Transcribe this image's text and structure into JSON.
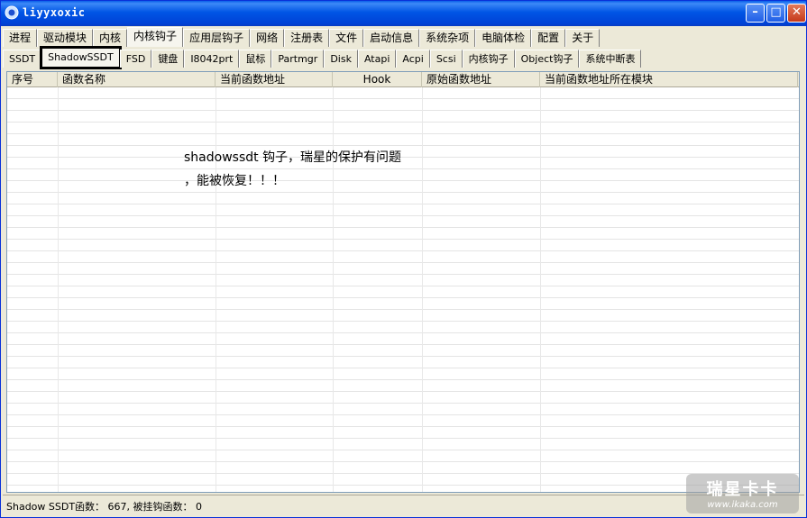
{
  "window": {
    "title": "liyyxoxic",
    "min_label": "–",
    "max_label": "□",
    "close_label": "✕"
  },
  "main_tabs": [
    "进程",
    "驱动模块",
    "内核",
    "内核钩子",
    "应用层钩子",
    "网络",
    "注册表",
    "文件",
    "启动信息",
    "系统杂项",
    "电脑体检",
    "配置",
    "关于"
  ],
  "sub_tabs": [
    "SSDT",
    "ShadowSSDT",
    "FSD",
    "键盘",
    "I8042prt",
    "鼠标",
    "Partmgr",
    "Disk",
    "Atapi",
    "Acpi",
    "Scsi",
    "内核钩子",
    "Object钩子",
    "系统中断表"
  ],
  "columns": [
    "序号",
    "函数名称",
    "当前函数地址",
    "Hook",
    "原始函数地址",
    "当前函数地址所在模块"
  ],
  "annotation": {
    "line1": "shadowssdt 钩子，瑞星的保护有问题",
    "line2": "，能被恢复！！！"
  },
  "status": {
    "text": "Shadow SSDT函数： 667, 被挂钩函数： 0"
  },
  "watermark": {
    "brand": "瑞星卡卡",
    "url": "www.ikaka.com"
  },
  "colors": {
    "titlebar": "#0055e5",
    "window_bg": "#ece9d8"
  }
}
